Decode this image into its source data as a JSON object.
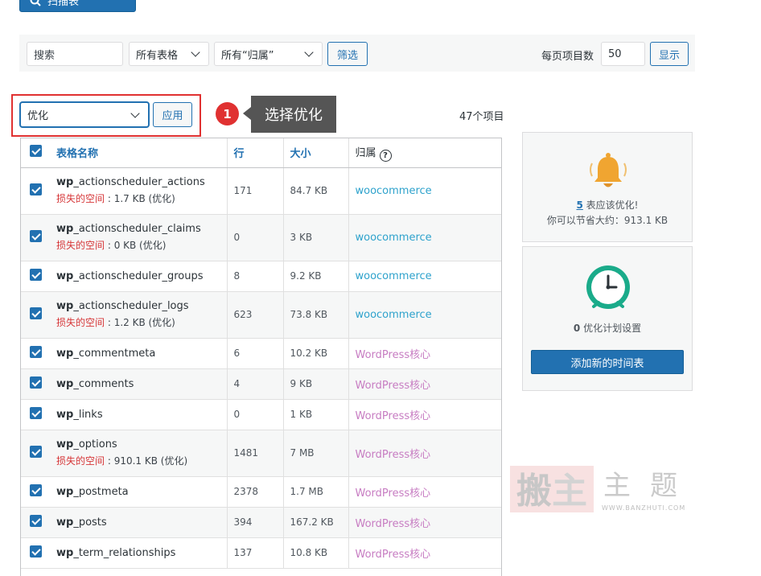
{
  "top": {
    "scan_label": "扫描表"
  },
  "filters": {
    "search_placeholder": "搜索",
    "table_select": "所有表格",
    "owner_select": "所有“归属”",
    "filter_button": "筛选",
    "per_page_label": "每页项目数",
    "per_page_value": "50",
    "show_button": "显示"
  },
  "bulk": {
    "action": "优化",
    "apply_button": "应用",
    "step_number": "1",
    "tooltip": "选择优化",
    "item_count": "47个项目"
  },
  "table": {
    "headers": {
      "name": "表格名称",
      "rows": "行",
      "size": "大小",
      "owner": "归属"
    },
    "rows": [
      {
        "prefix": "wp",
        "name": "_actionscheduler_actions",
        "lost_label": "损失的空间",
        "lost_value": "1.7 KB (优化)",
        "rows": "171",
        "size": "84.7 KB",
        "owner": "woocommerce"
      },
      {
        "prefix": "wp",
        "name": "_actionscheduler_claims",
        "lost_label": "损失的空间",
        "lost_value": "0 KB (优化)",
        "rows": "0",
        "size": "3 KB",
        "owner": "woocommerce"
      },
      {
        "prefix": "wp",
        "name": "_actionscheduler_groups",
        "lost_label": "",
        "lost_value": "",
        "rows": "8",
        "size": "9.2 KB",
        "owner": "woocommerce"
      },
      {
        "prefix": "wp",
        "name": "_actionscheduler_logs",
        "lost_label": "损失的空间",
        "lost_value": "1.2 KB (优化)",
        "rows": "623",
        "size": "73.8 KB",
        "owner": "woocommerce"
      },
      {
        "prefix": "wp",
        "name": "_commentmeta",
        "lost_label": "",
        "lost_value": "",
        "rows": "6",
        "size": "10.2 KB",
        "owner": "WordPress核心"
      },
      {
        "prefix": "wp",
        "name": "_comments",
        "lost_label": "",
        "lost_value": "",
        "rows": "4",
        "size": "9 KB",
        "owner": "WordPress核心"
      },
      {
        "prefix": "wp",
        "name": "_links",
        "lost_label": "",
        "lost_value": "",
        "rows": "0",
        "size": "1 KB",
        "owner": "WordPress核心"
      },
      {
        "prefix": "wp",
        "name": "_options",
        "lost_label": "损失的空间",
        "lost_value": "910.1 KB (优化)",
        "rows": "1481",
        "size": "7 MB",
        "owner": "WordPress核心"
      },
      {
        "prefix": "wp",
        "name": "_postmeta",
        "lost_label": "",
        "lost_value": "",
        "rows": "2378",
        "size": "1.7 MB",
        "owner": "WordPress核心"
      },
      {
        "prefix": "wp",
        "name": "_posts",
        "lost_label": "",
        "lost_value": "",
        "rows": "394",
        "size": "167.2 KB",
        "owner": "WordPress核心"
      },
      {
        "prefix": "wp",
        "name": "_term_relationships",
        "lost_label": "",
        "lost_value": "",
        "rows": "137",
        "size": "10.8 KB",
        "owner": "WordPress核心"
      }
    ]
  },
  "optimize_panel": {
    "count": "5",
    "text": " 表应该优化!",
    "savings": "你可以节省大约：913.1 KB"
  },
  "schedule_panel": {
    "count": "0",
    "text": " 优化计划设置",
    "add_button": "添加新的时间表"
  },
  "watermark": {
    "site": "WWW.BANZHUTI.COM"
  },
  "colors": {
    "primary": "#2271b1",
    "woo": "#2ea2cc",
    "core": "#c77cc2",
    "alert": "#e03131",
    "bell": "#f0a531",
    "clock": "#1aab8a"
  }
}
